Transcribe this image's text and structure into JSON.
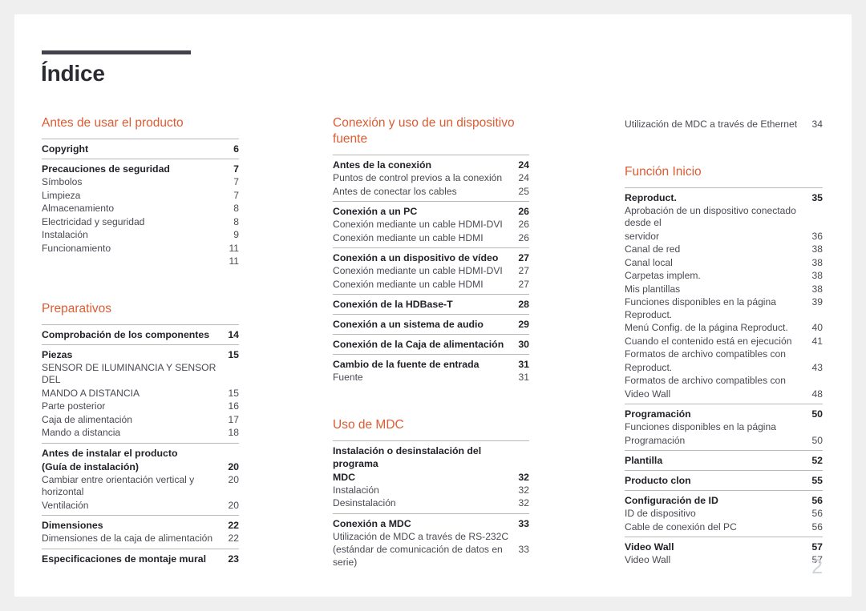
{
  "document": {
    "title": "Índice",
    "folio": "2",
    "accent_color": "#dd5c33",
    "rule_color": "#42424d"
  },
  "columns": [
    {
      "name": "column-1",
      "sections": [
        {
          "heading": "Antes de usar el producto",
          "groups": [
            {
              "entries": [
                {
                  "label": "Copyright",
                  "page": "6",
                  "level": "major"
                }
              ]
            },
            {
              "entries": [
                {
                  "label": "Precauciones de seguridad",
                  "page": "7",
                  "level": "major"
                },
                {
                  "label": "Símbolos",
                  "page": "7",
                  "level": "minor"
                },
                {
                  "label": "Limpieza",
                  "page": "7",
                  "level": "minor"
                },
                {
                  "label": "Almacenamiento",
                  "page": "8",
                  "level": "minor"
                },
                {
                  "label": "Electricidad y seguridad",
                  "page": "8",
                  "level": "minor"
                },
                {
                  "label": "Instalación",
                  "page": "9",
                  "level": "minor"
                },
                {
                  "label": "Funcionamiento",
                  "page": "11",
                  "level": "minor"
                },
                {
                  "label": "",
                  "page": "11",
                  "level": "minor"
                }
              ]
            }
          ]
        },
        {
          "heading": "Preparativos",
          "groups": [
            {
              "entries": [
                {
                  "label": "Comprobación de los componentes",
                  "page": "14",
                  "level": "major"
                }
              ]
            },
            {
              "entries": [
                {
                  "label": "Piezas",
                  "page": "15",
                  "level": "major"
                },
                {
                  "label": "SENSOR DE ILUMINANCIA Y SENSOR DEL",
                  "page": "",
                  "level": "minor"
                },
                {
                  "label": "MANDO A DISTANCIA",
                  "page": "15",
                  "level": "minor"
                },
                {
                  "label": "Parte posterior",
                  "page": "16",
                  "level": "minor"
                },
                {
                  "label": "Caja de alimentación",
                  "page": "17",
                  "level": "minor"
                },
                {
                  "label": "Mando a distancia",
                  "page": "18",
                  "level": "minor"
                }
              ]
            },
            {
              "entries": [
                {
                  "label": "Antes de instalar el producto",
                  "page": "",
                  "level": "major"
                },
                {
                  "label": "(Guía de instalación)",
                  "page": "20",
                  "level": "major"
                },
                {
                  "label": "Cambiar entre orientación vertical y horizontal",
                  "page": "20",
                  "level": "minor"
                },
                {
                  "label": "Ventilación",
                  "page": "20",
                  "level": "minor"
                }
              ]
            },
            {
              "entries": [
                {
                  "label": "Dimensiones",
                  "page": "22",
                  "level": "major"
                },
                {
                  "label": "Dimensiones de la caja de alimentación",
                  "page": "22",
                  "level": "minor"
                }
              ]
            },
            {
              "entries": [
                {
                  "label": "Especificaciones de montaje mural",
                  "page": "23",
                  "level": "major"
                }
              ]
            }
          ]
        }
      ]
    },
    {
      "name": "column-2",
      "sections": [
        {
          "heading": "Conexión y uso de un dispositivo fuente",
          "groups": [
            {
              "entries": [
                {
                  "label": "Antes de la conexión",
                  "page": "24",
                  "level": "major"
                },
                {
                  "label": "Puntos de control previos a la conexión",
                  "page": "24",
                  "level": "minor"
                },
                {
                  "label": "Antes de conectar los cables",
                  "page": "25",
                  "level": "minor"
                }
              ]
            },
            {
              "entries": [
                {
                  "label": "Conexión a un PC",
                  "page": "26",
                  "level": "major"
                },
                {
                  "label": "Conexión mediante un cable HDMI-DVI",
                  "page": "26",
                  "level": "minor"
                },
                {
                  "label": "Conexión mediante un cable HDMI",
                  "page": "26",
                  "level": "minor"
                }
              ]
            },
            {
              "entries": [
                {
                  "label": "Conexión a un dispositivo de vídeo",
                  "page": "27",
                  "level": "major"
                },
                {
                  "label": "Conexión mediante un cable HDMI-DVI",
                  "page": "27",
                  "level": "minor"
                },
                {
                  "label": "Conexión mediante un cable HDMI",
                  "page": "27",
                  "level": "minor"
                }
              ]
            },
            {
              "entries": [
                {
                  "label": "Conexión de la HDBase-T",
                  "page": "28",
                  "level": "major"
                }
              ]
            },
            {
              "entries": [
                {
                  "label": "Conexión a un sistema de audio",
                  "page": "29",
                  "level": "major"
                }
              ]
            },
            {
              "entries": [
                {
                  "label": "Conexión de la Caja de alimentación",
                  "page": "30",
                  "level": "major"
                }
              ]
            },
            {
              "entries": [
                {
                  "label": "Cambio de la fuente de entrada",
                  "page": "31",
                  "level": "major"
                },
                {
                  "label": "Fuente",
                  "page": "31",
                  "level": "minor"
                }
              ]
            }
          ]
        },
        {
          "heading": "Uso de MDC",
          "groups": [
            {
              "entries": [
                {
                  "label": "Instalación o desinstalación del programa",
                  "page": "",
                  "level": "major"
                },
                {
                  "label": "MDC",
                  "page": "32",
                  "level": "major"
                },
                {
                  "label": "Instalación",
                  "page": "32",
                  "level": "minor"
                },
                {
                  "label": "Desinstalación",
                  "page": "32",
                  "level": "minor"
                }
              ]
            },
            {
              "entries": [
                {
                  "label": "Conexión a MDC",
                  "page": "33",
                  "level": "major"
                },
                {
                  "label": "Utilización de MDC a través de RS-232C",
                  "page": "",
                  "level": "minor"
                },
                {
                  "label": "(estándar de comunicación de datos en serie)",
                  "page": "33",
                  "level": "minor"
                }
              ]
            }
          ]
        }
      ]
    },
    {
      "name": "column-3",
      "sections": [
        {
          "heading": "",
          "groups": [
            {
              "no_rule": true,
              "entries": [
                {
                  "label": "Utilización de MDC a través de Ethernet",
                  "page": "34",
                  "level": "minor"
                }
              ]
            }
          ]
        },
        {
          "heading": "Función Inicio",
          "groups": [
            {
              "entries": [
                {
                  "label": "Reproduct.",
                  "page": "35",
                  "level": "major"
                },
                {
                  "label": "Aprobación de un dispositivo conectado desde el",
                  "page": "",
                  "level": "minor"
                },
                {
                  "label": "servidor",
                  "page": "36",
                  "level": "minor"
                },
                {
                  "label": "Canal de red",
                  "page": "38",
                  "level": "minor"
                },
                {
                  "label": "Canal local",
                  "page": "38",
                  "level": "minor"
                },
                {
                  "label": "Carpetas implem.",
                  "page": "38",
                  "level": "minor"
                },
                {
                  "label": "Mis plantillas",
                  "page": "38",
                  "level": "minor"
                },
                {
                  "label": "Funciones disponibles en la página Reproduct.",
                  "page": "39",
                  "level": "minor"
                },
                {
                  "label": "Menú Config. de la página Reproduct.",
                  "page": "40",
                  "level": "minor"
                },
                {
                  "label": "Cuando el contenido está en ejecución",
                  "page": "41",
                  "level": "minor"
                },
                {
                  "label": "Formatos de archivo compatibles con",
                  "page": "",
                  "level": "minor"
                },
                {
                  "label": "Reproduct.",
                  "page": "43",
                  "level": "minor"
                },
                {
                  "label": "Formatos de archivo compatibles con",
                  "page": "",
                  "level": "minor"
                },
                {
                  "label": "Video Wall",
                  "page": "48",
                  "level": "minor"
                }
              ]
            },
            {
              "entries": [
                {
                  "label": "Programación",
                  "page": "50",
                  "level": "major"
                },
                {
                  "label": "Funciones disponibles en la página",
                  "page": "",
                  "level": "minor"
                },
                {
                  "label": "Programación",
                  "page": "50",
                  "level": "minor"
                }
              ]
            },
            {
              "entries": [
                {
                  "label": "Plantilla",
                  "page": "52",
                  "level": "major"
                }
              ]
            },
            {
              "entries": [
                {
                  "label": "Producto clon",
                  "page": "55",
                  "level": "major"
                }
              ]
            },
            {
              "entries": [
                {
                  "label": "Configuración de ID",
                  "page": "56",
                  "level": "major"
                },
                {
                  "label": "ID de dispositivo",
                  "page": "56",
                  "level": "minor"
                },
                {
                  "label": "Cable de conexión del PC",
                  "page": "56",
                  "level": "minor"
                }
              ]
            },
            {
              "entries": [
                {
                  "label": "Video Wall",
                  "page": "57",
                  "level": "major"
                },
                {
                  "label": "Video Wall",
                  "page": "57",
                  "level": "minor"
                }
              ]
            }
          ]
        }
      ]
    }
  ]
}
